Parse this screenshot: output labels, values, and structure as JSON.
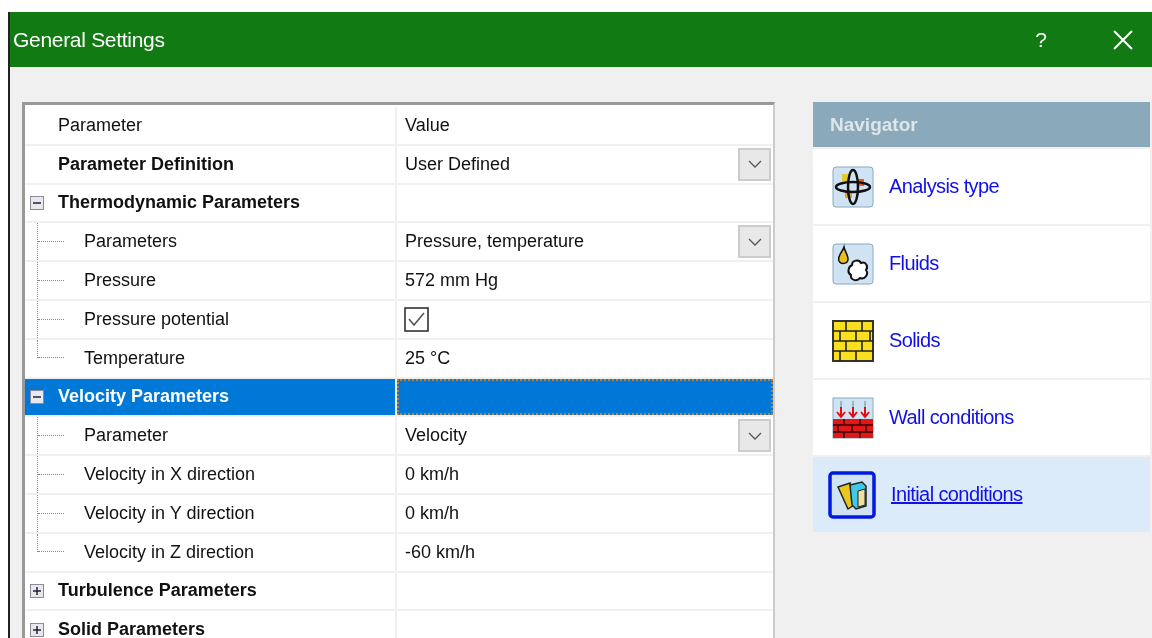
{
  "window": {
    "title": "General Settings",
    "help": "?"
  },
  "grid": {
    "columns": [
      "Parameter",
      "Value"
    ],
    "rows": [
      {
        "kind": "dropdown",
        "label": "Parameter Definition",
        "value": "User Defined",
        "selected": false
      },
      {
        "kind": "group",
        "label": "Thermodynamic Parameters",
        "expanded": true,
        "selected": false,
        "children": [
          {
            "kind": "dropdown",
            "label": "Parameters",
            "value": "Pressure, temperature",
            "selected": false
          },
          {
            "kind": "text",
            "label": "Pressure",
            "value": "572 mm Hg",
            "selected": false
          },
          {
            "kind": "checkbox",
            "label": "Pressure potential",
            "checked": true,
            "selected": false
          },
          {
            "kind": "text",
            "label": "Temperature",
            "value": "25 °C",
            "selected": false
          }
        ]
      },
      {
        "kind": "group",
        "label": "Velocity Parameters",
        "expanded": true,
        "selected": true,
        "children": [
          {
            "kind": "dropdown",
            "label": "Parameter",
            "value": "Velocity",
            "selected": false
          },
          {
            "kind": "text",
            "label": "Velocity in X direction",
            "value": "0 km/h",
            "selected": false
          },
          {
            "kind": "text",
            "label": "Velocity in Y direction",
            "value": "0 km/h",
            "selected": false
          },
          {
            "kind": "text",
            "label": "Velocity in Z direction",
            "value": "-60 km/h",
            "selected": false
          }
        ]
      },
      {
        "kind": "group",
        "label": "Turbulence Parameters",
        "expanded": false,
        "selected": false
      },
      {
        "kind": "group",
        "label": "Solid Parameters",
        "expanded": false,
        "selected": false
      }
    ]
  },
  "navigator": {
    "title": "Navigator",
    "items": [
      {
        "kind": "analysis",
        "label": "Analysis type",
        "selected": false
      },
      {
        "kind": "fluids",
        "label": "Fluids",
        "selected": false
      },
      {
        "kind": "solids",
        "label": "Solids",
        "selected": false
      },
      {
        "kind": "wall",
        "label": "Wall conditions",
        "selected": false
      },
      {
        "kind": "initial",
        "label": "Initial conditions",
        "selected": true
      }
    ]
  }
}
